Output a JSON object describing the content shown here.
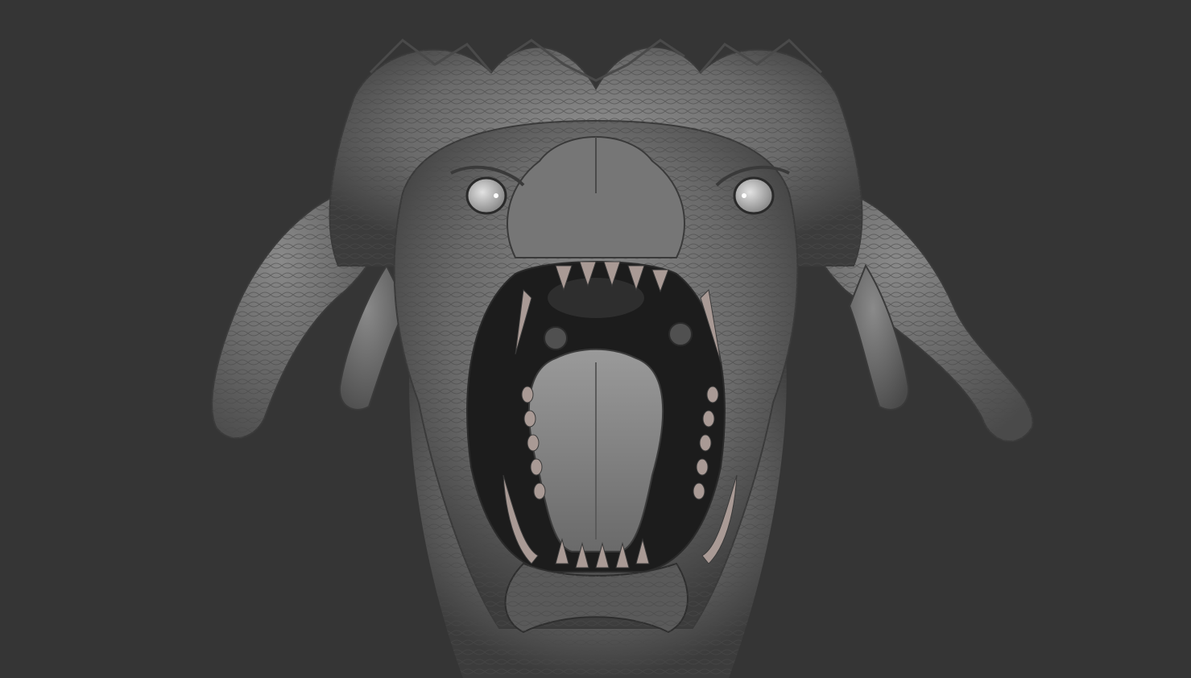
{
  "viewport": {
    "background_color": "#353535",
    "subject": "sculpted-dragon-head",
    "material_colors": {
      "skin_light": "#8e8e8e",
      "skin_mid": "#6a6a6a",
      "skin_dark": "#3c3c3c",
      "mouth_interior": "#1c1c1c",
      "teeth": "#a99a95",
      "tongue": "#7d7d7d",
      "eye": "#c9c9c9"
    }
  }
}
